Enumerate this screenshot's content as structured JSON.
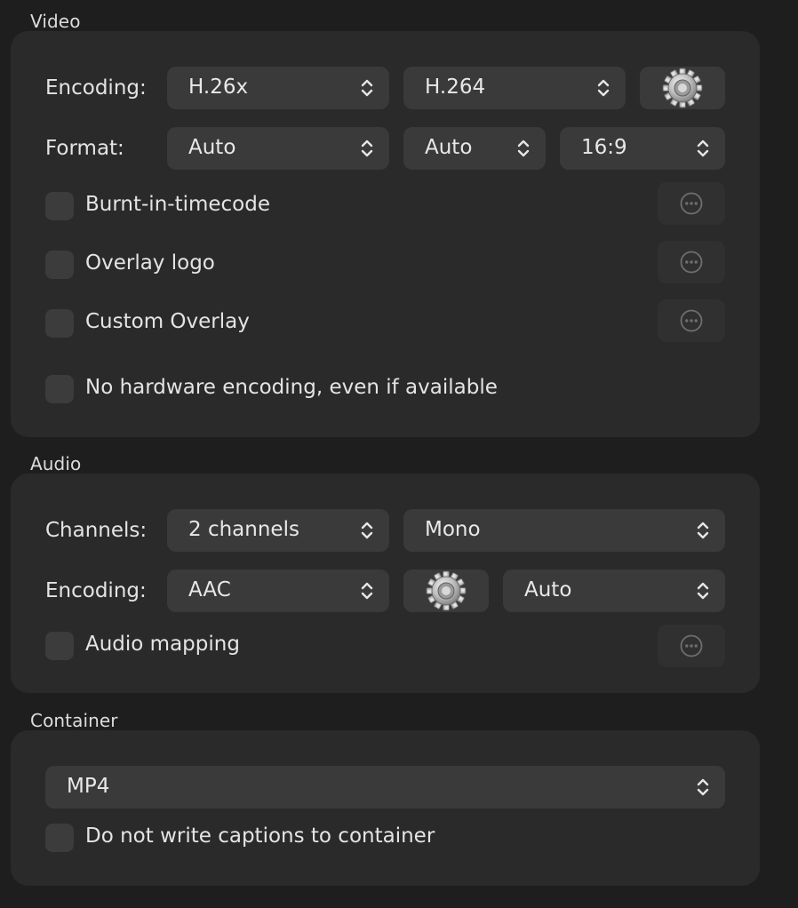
{
  "video": {
    "title": "Video",
    "encoding_label": "Encoding:",
    "encoding_family": "H.26x",
    "encoding_codec": "H.264",
    "format_label": "Format:",
    "format_main": "Auto",
    "format_secondary": "Auto",
    "format_aspect": "16:9",
    "options": [
      {
        "label": "Burnt-in-timecode",
        "checked": false
      },
      {
        "label": "Overlay logo",
        "checked": false
      },
      {
        "label": "Custom Overlay",
        "checked": false
      }
    ],
    "no_hw_label": "No hardware encoding, even if available"
  },
  "audio": {
    "title": "Audio",
    "channels_label": "Channels:",
    "channels_value": "2 channels",
    "channel_mode": "Mono",
    "encoding_label": "Encoding:",
    "encoding_value": "AAC",
    "bitrate_value": "Auto",
    "mapping_label": "Audio mapping"
  },
  "container": {
    "title": "Container",
    "format_value": "MP4",
    "no_captions_label": "Do not write captions to container"
  },
  "icons": {
    "chevron": "chevron-up-down-icon",
    "gear": "gear-icon",
    "more": "ellipsis-circle-icon"
  },
  "colors": {
    "background": "#1e1e1e",
    "panel": "#2a2a2a",
    "control": "#3a3a3a",
    "text": "#e4e4e4"
  }
}
